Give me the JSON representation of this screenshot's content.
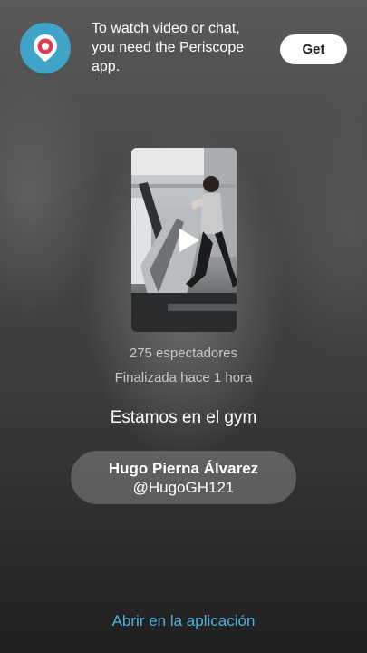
{
  "banner": {
    "icon": "periscope-logo-icon",
    "message": "To watch video or chat, you need the Periscope app.",
    "get_label": "Get"
  },
  "broadcast": {
    "play_icon": "play-icon",
    "viewers": "275 espectadores",
    "status": "Finalizada hace 1 hora",
    "title": "Estamos en el gym"
  },
  "user": {
    "name": "Hugo Pierna Álvarez",
    "handle": "@HugoGH121"
  },
  "footer": {
    "open_app_label": "Abrir en la aplicación"
  },
  "colors": {
    "accent": "#4fb0dc",
    "brand_icon": "#3fa4c8",
    "brand_red": "#e03a4e"
  }
}
